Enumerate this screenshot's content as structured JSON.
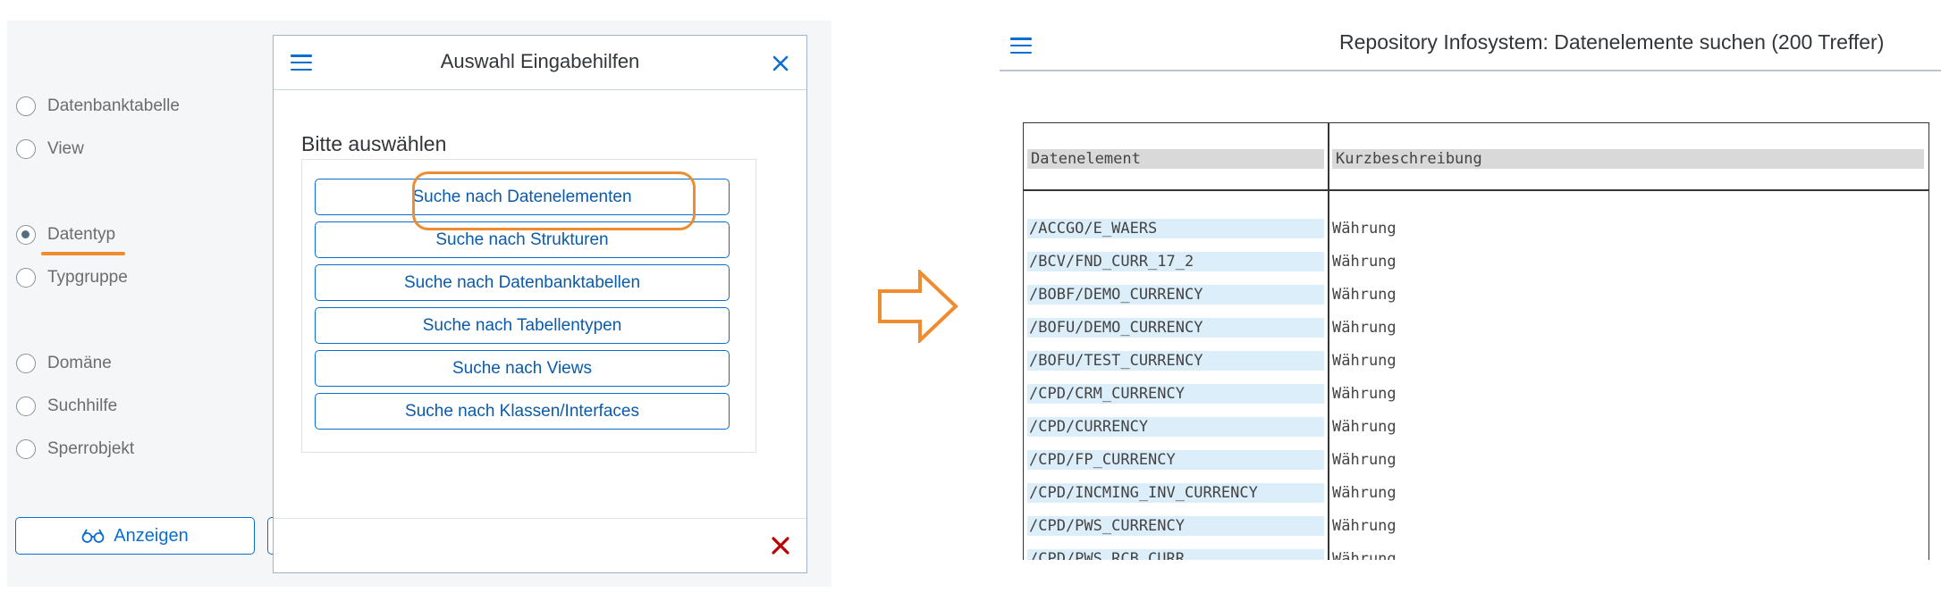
{
  "left_panel": {
    "radio_options": [
      {
        "label": "Datenbanktabelle",
        "checked": false
      },
      {
        "label": "View",
        "checked": false
      },
      {
        "label": "Datentyp",
        "checked": true
      },
      {
        "label": "Typgruppe",
        "checked": false
      },
      {
        "label": "Domäne",
        "checked": false
      },
      {
        "label": "Suchhilfe",
        "checked": false
      },
      {
        "label": "Sperrobjekt",
        "checked": false
      }
    ],
    "anzeigen_label": "Anzeigen",
    "anzeigen_icon": "glasses-icon"
  },
  "dialog": {
    "title": "Auswahl Eingabehilfen",
    "subtitle": "Bitte auswählen",
    "buttons": [
      "Suche nach Datenelementen",
      "Suche nach Strukturen",
      "Suche nach Datenbanktabellen",
      "Suche nach Tabellentypen",
      "Suche nach Views",
      "Suche nach Klassen/Interfaces"
    ],
    "highlighted_button_index": 0
  },
  "result_screen": {
    "title": "Repository Infosystem: Datenelemente suchen (200 Treffer)",
    "columns": [
      "Datenelement",
      "Kurzbeschreibung"
    ],
    "rows": [
      [
        "/ACCGO/E_WAERS",
        "Währung"
      ],
      [
        "/BCV/FND_CURR_17_2",
        "Währung"
      ],
      [
        "/BOBF/DEMO_CURRENCY",
        "Währung"
      ],
      [
        "/BOFU/DEMO_CURRENCY",
        "Währung"
      ],
      [
        "/BOFU/TEST_CURRENCY",
        "Währung"
      ],
      [
        "/CPD/CRM_CURRENCY",
        "Währung"
      ],
      [
        "/CPD/CURRENCY",
        "Währung"
      ],
      [
        "/CPD/FP_CURRENCY",
        "Währung"
      ],
      [
        "/CPD/INCMING_INV_CURRENCY",
        "Währung"
      ],
      [
        "/CPD/PWS_CURRENCY",
        "Währung"
      ],
      [
        "/CPD/PWS_RCB_CURR",
        "Währung"
      ]
    ]
  },
  "colors": {
    "accent": "#0a6ed1",
    "highlight": "#f08c30",
    "close_red": "#bb0000"
  }
}
